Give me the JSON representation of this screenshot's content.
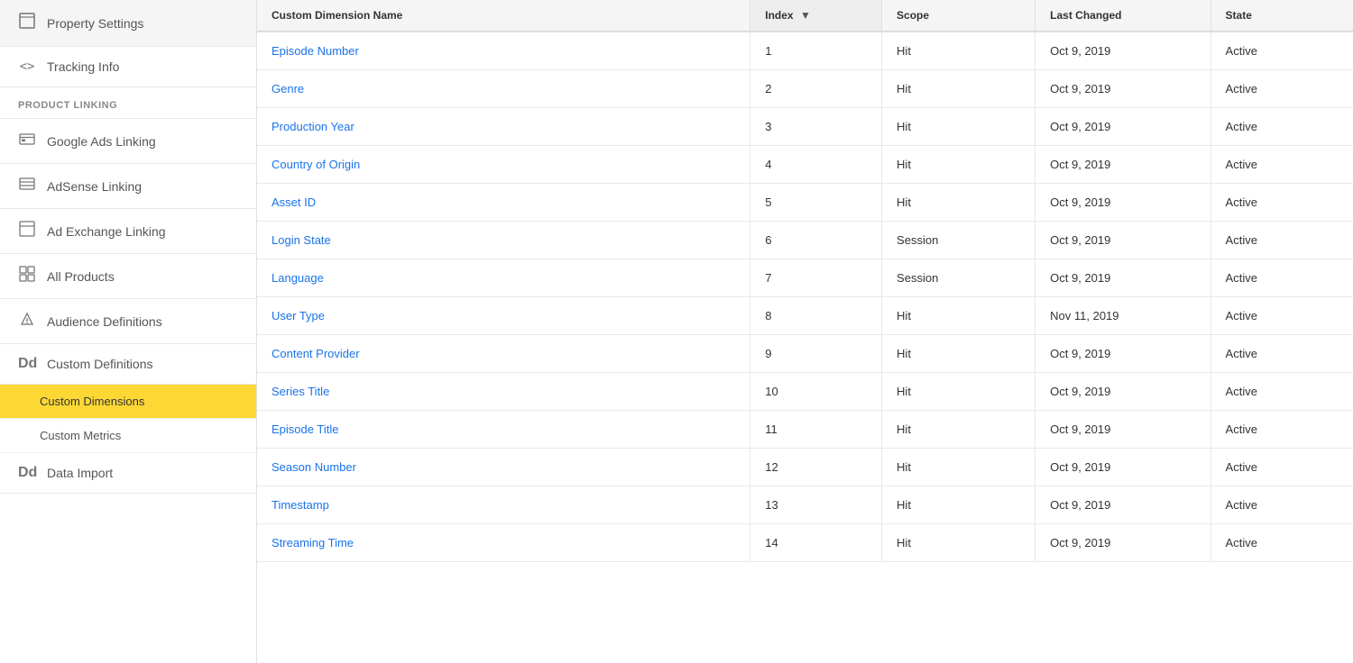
{
  "sidebar": {
    "items": [
      {
        "id": "property-settings",
        "label": "Property Settings",
        "icon": "⬜"
      },
      {
        "id": "tracking-info",
        "label": "Tracking Info",
        "icon": "<>"
      }
    ],
    "section_product_linking": "PRODUCT LINKING",
    "product_linking_items": [
      {
        "id": "google-ads-linking",
        "label": "Google Ads Linking",
        "icon": "▦"
      },
      {
        "id": "adsense-linking",
        "label": "AdSense Linking",
        "icon": "▤"
      },
      {
        "id": "ad-exchange-linking",
        "label": "Ad Exchange Linking",
        "icon": "⬜"
      },
      {
        "id": "all-products",
        "label": "All Products",
        "icon": "⊞"
      }
    ],
    "standalone_items": [
      {
        "id": "audience-definitions",
        "label": "Audience Definitions",
        "icon": "⚙"
      },
      {
        "id": "custom-definitions",
        "label": "Custom Definitions",
        "icon": "Dd"
      }
    ],
    "sub_items": [
      {
        "id": "custom-dimensions",
        "label": "Custom Dimensions",
        "active": true
      },
      {
        "id": "custom-metrics",
        "label": "Custom Metrics",
        "active": false
      }
    ],
    "bottom_items": [
      {
        "id": "data-import",
        "label": "Data Import",
        "icon": "Dd"
      }
    ]
  },
  "table": {
    "columns": [
      {
        "id": "name",
        "label": "Custom Dimension Name"
      },
      {
        "id": "index",
        "label": "Index",
        "sorted": true,
        "sort_dir": "desc"
      },
      {
        "id": "scope",
        "label": "Scope"
      },
      {
        "id": "last_changed",
        "label": "Last Changed"
      },
      {
        "id": "state",
        "label": "State"
      }
    ],
    "rows": [
      {
        "name": "Episode Number",
        "index": "1",
        "scope": "Hit",
        "last_changed": "Oct 9, 2019",
        "state": "Active"
      },
      {
        "name": "Genre",
        "index": "2",
        "scope": "Hit",
        "last_changed": "Oct 9, 2019",
        "state": "Active"
      },
      {
        "name": "Production Year",
        "index": "3",
        "scope": "Hit",
        "last_changed": "Oct 9, 2019",
        "state": "Active"
      },
      {
        "name": "Country of Origin",
        "index": "4",
        "scope": "Hit",
        "last_changed": "Oct 9, 2019",
        "state": "Active"
      },
      {
        "name": "Asset ID",
        "index": "5",
        "scope": "Hit",
        "last_changed": "Oct 9, 2019",
        "state": "Active"
      },
      {
        "name": "Login State",
        "index": "6",
        "scope": "Session",
        "last_changed": "Oct 9, 2019",
        "state": "Active"
      },
      {
        "name": "Language",
        "index": "7",
        "scope": "Session",
        "last_changed": "Oct 9, 2019",
        "state": "Active"
      },
      {
        "name": "User Type",
        "index": "8",
        "scope": "Hit",
        "last_changed": "Nov 11, 2019",
        "state": "Active"
      },
      {
        "name": "Content Provider",
        "index": "9",
        "scope": "Hit",
        "last_changed": "Oct 9, 2019",
        "state": "Active"
      },
      {
        "name": "Series Title",
        "index": "10",
        "scope": "Hit",
        "last_changed": "Oct 9, 2019",
        "state": "Active"
      },
      {
        "name": "Episode Title",
        "index": "11",
        "scope": "Hit",
        "last_changed": "Oct 9, 2019",
        "state": "Active"
      },
      {
        "name": "Season Number",
        "index": "12",
        "scope": "Hit",
        "last_changed": "Oct 9, 2019",
        "state": "Active"
      },
      {
        "name": "Timestamp",
        "index": "13",
        "scope": "Hit",
        "last_changed": "Oct 9, 2019",
        "state": "Active"
      },
      {
        "name": "Streaming Time",
        "index": "14",
        "scope": "Hit",
        "last_changed": "Oct 9, 2019",
        "state": "Active"
      }
    ]
  }
}
